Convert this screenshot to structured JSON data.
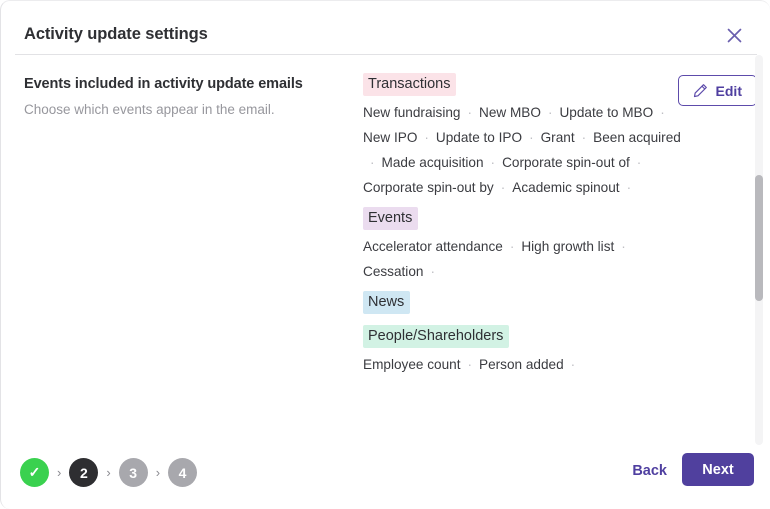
{
  "dialog": {
    "title": "Activity update settings",
    "close_icon": "close-icon"
  },
  "left": {
    "heading": "Events included in activity update emails",
    "subtext": "Choose which events appear in the email."
  },
  "edit_button": {
    "label": "Edit",
    "icon": "pencil-icon"
  },
  "categories": [
    {
      "name": "Transactions",
      "color": "#fbe3e8",
      "items": [
        "New fundraising",
        "New MBO",
        "Update to MBO",
        "New IPO",
        "Update to IPO",
        "Grant",
        "Been acquired",
        "Made acquisition",
        "Corporate spin-out of",
        "Corporate spin-out by",
        "Academic spinout"
      ]
    },
    {
      "name": "Events",
      "color": "#ebdcef",
      "items": [
        "Accelerator attendance",
        "High growth list",
        "Cessation"
      ]
    },
    {
      "name": "News",
      "color": "#cfe7f3",
      "items": []
    },
    {
      "name": "People/Shareholders",
      "color": "#d2f2e4",
      "items": [
        "Employee count",
        "Person added"
      ]
    }
  ],
  "footer": {
    "steps": [
      {
        "label": "✓",
        "state": "done"
      },
      {
        "label": "2",
        "state": "active"
      },
      {
        "label": "3",
        "state": "todo"
      },
      {
        "label": "4",
        "state": "todo"
      }
    ],
    "step_separator": "›",
    "back_label": "Back",
    "next_label": "Next"
  }
}
